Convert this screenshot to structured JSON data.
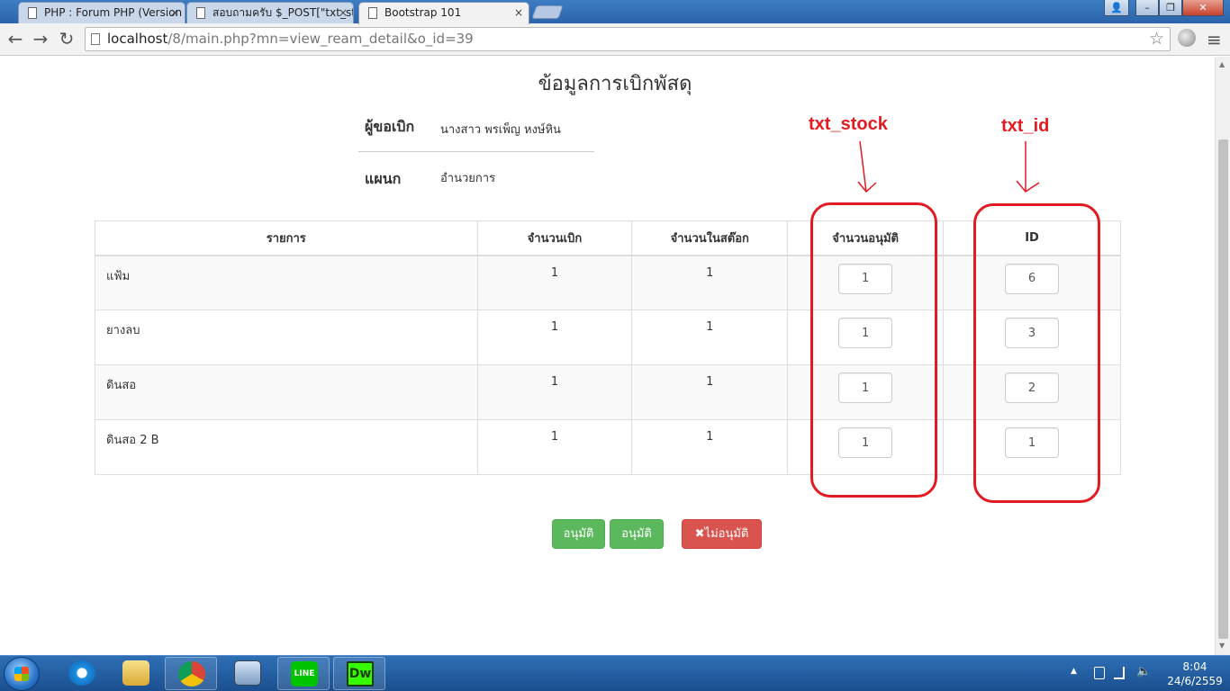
{
  "browser": {
    "tabs": [
      {
        "title": "PHP : Forum PHP (Version"
      },
      {
        "title": "สอบถามครับ $_POST[\"txt_st"
      },
      {
        "title": "Bootstrap 101"
      }
    ],
    "close_glyph": "×",
    "url_host": "localhost",
    "url_path": "/8/main.php?mn=view_ream_detail&o_id=39",
    "nav": {
      "back": "←",
      "forward": "→",
      "reload": "↻",
      "star": "☆",
      "menu": "≡"
    },
    "window_buttons": {
      "user": "👤",
      "minimize": "–",
      "restore": "❐",
      "close": "✕"
    }
  },
  "page": {
    "title": "ข้อมูลการเบิกพัสดุ",
    "requester_label": "ผู้ขอเบิก",
    "requester_value": "นางสาว พรเพ็ญ หงษ์หิน",
    "department_label": "แผนก",
    "department_value": "อำนวยการ",
    "columns": [
      "รายการ",
      "จำนวนเบิก",
      "จำนวนในสต๊อก",
      "จำนวนอนุมัติ",
      "ID"
    ],
    "rows": [
      {
        "item": "แฟ้ม",
        "requested": "1",
        "stock": "1",
        "approved": "1",
        "id": "6"
      },
      {
        "item": "ยางลบ",
        "requested": "1",
        "stock": "1",
        "approved": "1",
        "id": "3"
      },
      {
        "item": "ดินสอ",
        "requested": "1",
        "stock": "1",
        "approved": "1",
        "id": "2"
      },
      {
        "item": "ดินสอ 2 B",
        "requested": "1",
        "stock": "1",
        "approved": "1",
        "id": "1"
      }
    ],
    "buttons": {
      "approve_1": "อนุมัติ",
      "approve_2": "อนุมัติ",
      "reject_icon": "✖",
      "reject": "ไม่อนุมัติ"
    },
    "annotations": {
      "stock": "txt_stock",
      "id": "txt_id"
    }
  },
  "taskbar": {
    "apps": [
      "internet-explorer",
      "file-explorer",
      "chrome",
      "network",
      "line",
      "dreamweaver"
    ],
    "line_label": "LINE",
    "dw_label": "Dw",
    "time": "8:04",
    "date": "24/6/2559"
  },
  "colors": {
    "success": "#5cb85c",
    "danger": "#d9534f",
    "annotation": "#e21b23"
  }
}
